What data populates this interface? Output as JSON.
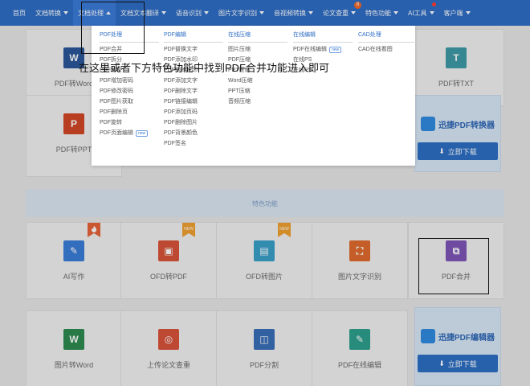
{
  "nav": [
    {
      "label": "首页",
      "caret": false
    },
    {
      "label": "文档转换",
      "caret": "down"
    },
    {
      "label": "文档处理",
      "caret": "up",
      "active": true
    },
    {
      "label": "文档文本翻译",
      "caret": "down"
    },
    {
      "label": "语音识别",
      "caret": "down"
    },
    {
      "label": "图片文字识别",
      "caret": "down"
    },
    {
      "label": "音视频转换",
      "caret": "down"
    },
    {
      "label": "论文查重",
      "caret": "down",
      "badge": "8"
    },
    {
      "label": "特色功能",
      "caret": "down"
    },
    {
      "label": "AI工具",
      "caret": "down",
      "dot": true
    },
    {
      "label": "客户端",
      "caret": "down"
    }
  ],
  "caption": "在这里或者下方特色功能中找到PDF合并功能进入即可",
  "dropdown": {
    "columns": [
      {
        "title": "PDF处理",
        "items": [
          {
            "label": "PDF合并"
          },
          {
            "label": "PDF拆分"
          },
          {
            "label": "PDF解密"
          },
          {
            "label": "PDF增加密码"
          },
          {
            "label": "PDF修改密码"
          },
          {
            "label": "PDF图片获取"
          },
          {
            "label": "PDF删除页"
          },
          {
            "label": "PDF旋转"
          },
          {
            "label": "PDF页面编辑",
            "new": "new"
          }
        ]
      },
      {
        "title": "PDF编辑",
        "items": [
          {
            "label": "PDF替换文字"
          },
          {
            "label": "PDF添加水印"
          },
          {
            "label": "PDF删除水印"
          },
          {
            "label": "PDF添加文字"
          },
          {
            "label": "PDF删除文字"
          },
          {
            "label": "PDF链接编辑"
          },
          {
            "label": "PDF添加页码"
          },
          {
            "label": "PDF删除图片"
          },
          {
            "label": "PDF背景颜色"
          },
          {
            "label": "PDF签名"
          }
        ]
      },
      {
        "title": "在线压缩",
        "items": [
          {
            "label": "图片压缩"
          },
          {
            "label": "PDF压缩"
          },
          {
            "label": "PPT压缩"
          },
          {
            "label": "Word压缩"
          },
          {
            "label": "PPT压缩"
          },
          {
            "label": "音频压缩"
          }
        ]
      },
      {
        "title": "在线编辑",
        "items": [
          {
            "label": "PDF在线编辑",
            "new": "new"
          },
          {
            "label": "在线PS"
          },
          {
            "label": "在线PS"
          }
        ]
      },
      {
        "title": "CAD处理",
        "items": [
          {
            "label": "CAD在线看图"
          }
        ]
      }
    ]
  },
  "tiles": {
    "row1": [
      {
        "label": "PDF转Word",
        "icon": "W",
        "color": "#2b579a"
      },
      {
        "label": "PDF转TXT",
        "icon": "T",
        "color": "#3e9aa7"
      }
    ],
    "row2": [
      {
        "label": "PDF转PPT",
        "icon": "P",
        "color": "#d24726"
      }
    ],
    "feature_bar": "特色功能",
    "row3": [
      {
        "label": "AI写作",
        "icon": "✎",
        "color": "#3b7dd8",
        "flag": "hot"
      },
      {
        "label": "OFD转PDF",
        "icon": "▣",
        "color": "#d9543b",
        "flag": "new"
      },
      {
        "label": "OFD转图片",
        "icon": "▤",
        "color": "#3aa0c9",
        "flag": "new"
      },
      {
        "label": "图片文字识别",
        "icon": "⛶",
        "color": "#e06a2e"
      },
      {
        "label": "PDF合并",
        "icon": "⧉",
        "color": "#7e56b8"
      }
    ],
    "row4": [
      {
        "label": "图片转Word",
        "icon": "W",
        "color": "#2d8a4f"
      },
      {
        "label": "上传论文查重",
        "icon": "◎",
        "color": "#d9543b"
      },
      {
        "label": "PDF分割",
        "icon": "◫",
        "color": "#3a6fb8"
      },
      {
        "label": "PDF在线编辑",
        "icon": "✎",
        "color": "#2da08d"
      }
    ]
  },
  "promo1": {
    "title": "迅捷PDF转换器",
    "button": "立即下载"
  },
  "promo2": {
    "title": "迅捷PDF编辑器",
    "button": "立即下载"
  },
  "colors": {
    "nav": "#2f6ec5",
    "link": "#2f6ec5"
  }
}
